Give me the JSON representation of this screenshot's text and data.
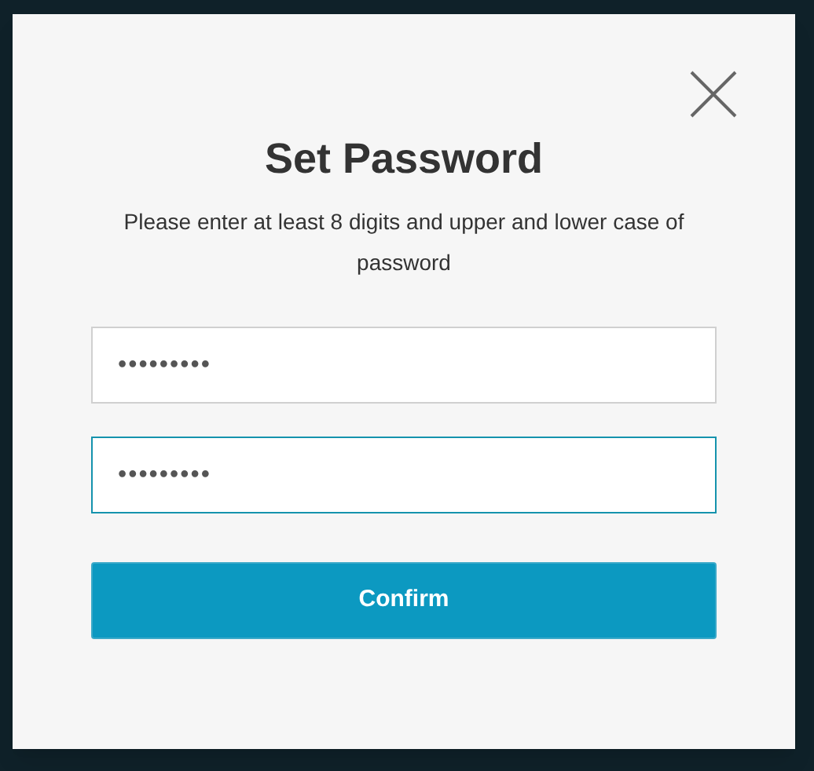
{
  "dialog": {
    "title": "Set Password",
    "description": "Please enter at least 8 digits and upper and lower case of password",
    "fields": [
      {
        "value": "•••••••••",
        "focused": false
      },
      {
        "value": "•••••••••",
        "focused": true
      }
    ],
    "confirm_button": "Confirm"
  }
}
